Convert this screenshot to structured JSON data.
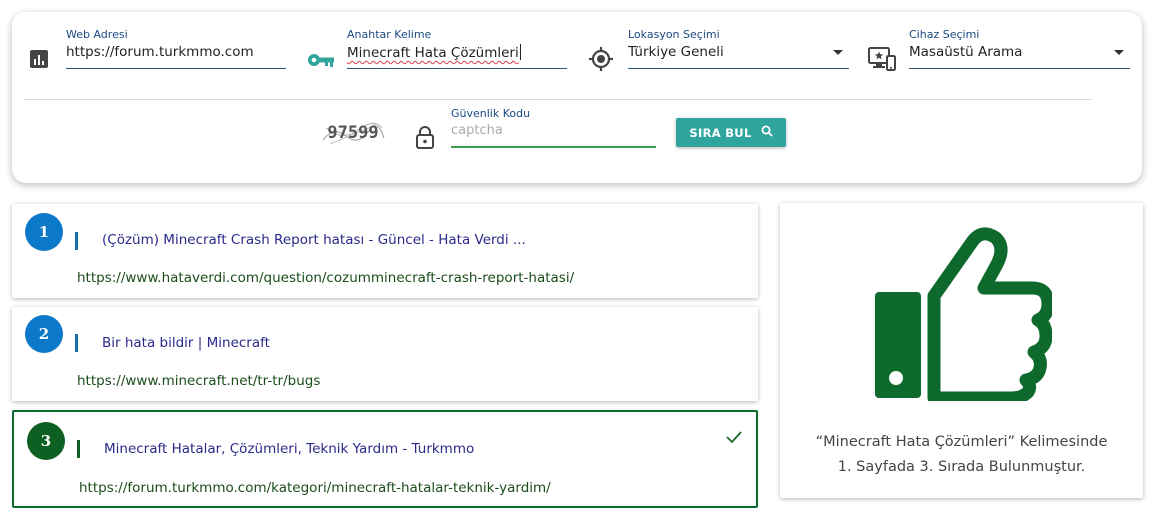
{
  "form": {
    "web_address": {
      "label": "Web Adresi",
      "value": "https://forum.turkmmo.com"
    },
    "keyword": {
      "label": "Anahtar Kelime",
      "value": "Minecraft Hata Çözümleri"
    },
    "location": {
      "label": "Lokasyon Seçimi",
      "value": "Türkiye Geneli"
    },
    "device": {
      "label": "Cihaz Seçimi",
      "value": "Masaüstü Arama"
    },
    "captcha": {
      "code": "97599",
      "label": "Güvenlik Kodu",
      "placeholder": "captcha"
    },
    "search_button": "SIRA BUL"
  },
  "results": [
    {
      "rank": "1",
      "title": "(Çözüm) Minecraft Crash Report hatası - Güncel - Hata Verdi ...",
      "url": "https://www.hataverdi.com/question/cozumminecraft-crash-report-hatasi/"
    },
    {
      "rank": "2",
      "title": "Bir hata bildir | Minecraft",
      "url": "https://www.minecraft.net/tr-tr/bugs"
    },
    {
      "rank": "3",
      "title": "Minecraft Hatalar, Çözümleri, Teknik Yardım - Turkmmo",
      "url": "https://forum.turkmmo.com/kategori/minecraft-hatalar-teknik-yardim/",
      "matched": true
    }
  ],
  "summary": {
    "line1": "“Minecraft Hata Çözümleri” Kelimesinde",
    "line2": "1. Sayfada 3. Sırada Bulunmuştur."
  },
  "colors": {
    "accent_teal": "#2fa59e",
    "rank_blue": "#0b78c8",
    "match_green": "#0e5f22",
    "title_purple": "#2a2a8a"
  },
  "icons": [
    "bar-chart-icon",
    "key-icon",
    "location-target-icon",
    "device-icon",
    "lock-icon",
    "search-icon",
    "check-icon",
    "thumbs-up-icon"
  ]
}
